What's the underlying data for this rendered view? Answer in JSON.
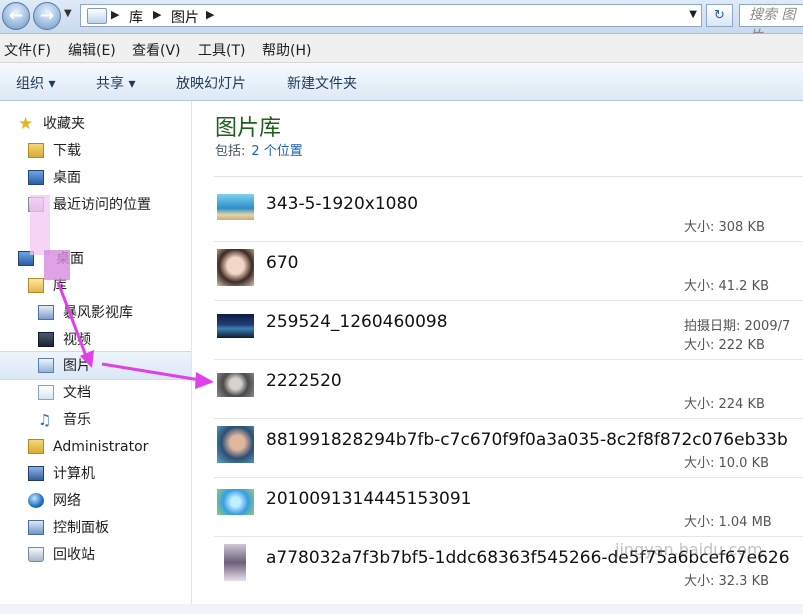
{
  "address": {
    "crumbs": [
      "库",
      "图片"
    ],
    "search_placeholder": "搜索 图片"
  },
  "menu": [
    "文件(F)",
    "编辑(E)",
    "查看(V)",
    "工具(T)",
    "帮助(H)"
  ],
  "toolbar": {
    "organize": "组织 ▾",
    "share": "共享 ▾",
    "slideshow": "放映幻灯片",
    "new_folder": "新建文件夹"
  },
  "nav": {
    "favorites": "收藏夹",
    "downloads": "下载",
    "desktop_fav": "桌面",
    "recent": "最近访问的位置",
    "desktop": "桌面",
    "libraries": "库",
    "storm": "暴风影视库",
    "videos": "视频",
    "pictures": "图片",
    "documents": "文档",
    "music": "音乐",
    "admin": "Administrator",
    "computer": "计算机",
    "network": "网络",
    "control_panel": "控制面板",
    "recycle": "回收站"
  },
  "library": {
    "title": "图片库",
    "includes_label": "包括:",
    "includes_link": "2 个位置"
  },
  "files": [
    {
      "name": "343-5-1920x1080",
      "size": "大小: 308 KB",
      "date": ""
    },
    {
      "name": "670",
      "size": "大小: 41.2 KB",
      "date": ""
    },
    {
      "name": "259524_1260460098",
      "size": "大小: 222 KB",
      "date": "拍摄日期: 2009/7"
    },
    {
      "name": "2222520",
      "size": "大小: 224 KB",
      "date": ""
    },
    {
      "name": "881991828294b7fb-c7c670f9f0a3a035-8c2f8f872c076eb33b",
      "size": "大小: 10.0 KB",
      "date": ""
    },
    {
      "name": "2010091314445153091",
      "size": "大小: 1.04 MB",
      "date": ""
    },
    {
      "name": "a778032a7f3b7bf5-1ddc68363f545266-de5f75a6bcef67e626",
      "size": "大小: 32.3 KB",
      "date": ""
    }
  ],
  "watermark": "jingyan.baidu.com",
  "colors": {
    "accent": "#1e5f1e",
    "link": "#1a5fb4",
    "arrow": "#e040e8"
  }
}
